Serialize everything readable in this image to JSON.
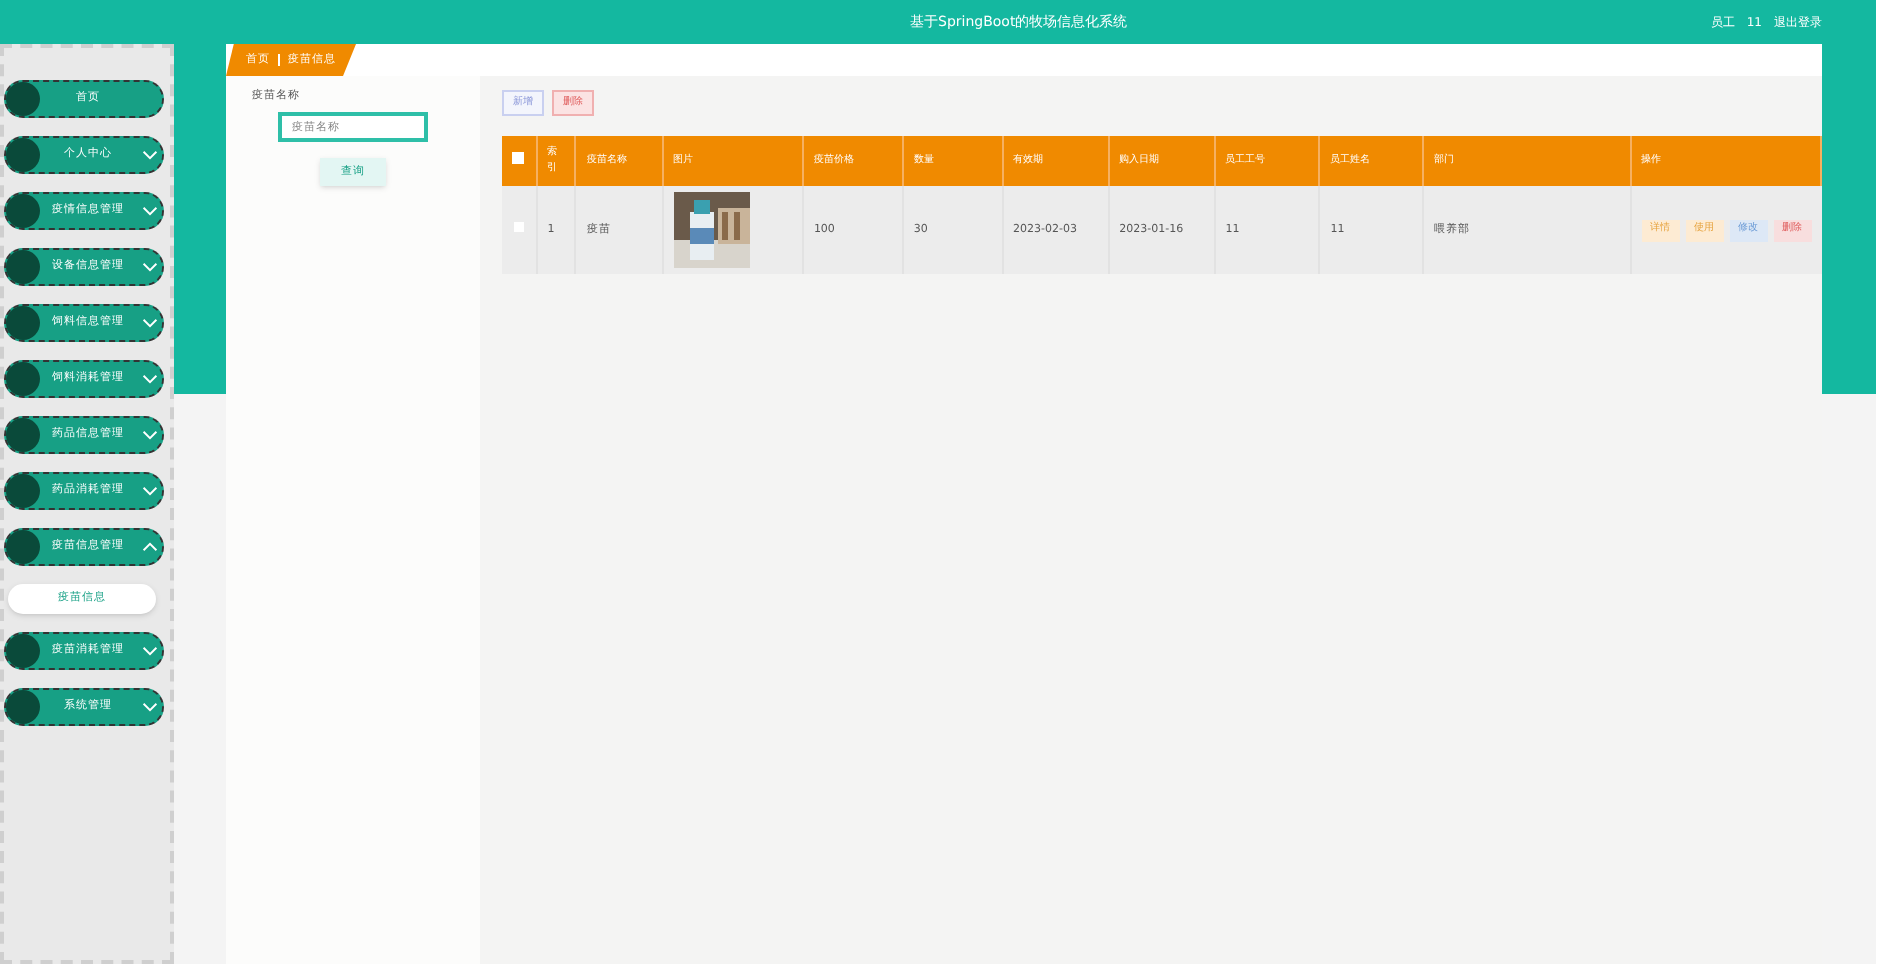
{
  "header": {
    "title": "基于SpringBoot的牧场信息化系统",
    "user_role": "员工",
    "user_name": "11",
    "logout": "退出登录"
  },
  "sidebar": {
    "items": [
      {
        "label": "首页"
      },
      {
        "label": "个人中心",
        "expanded": false
      },
      {
        "label": "疫情信息管理",
        "expanded": false
      },
      {
        "label": "设备信息管理",
        "expanded": false
      },
      {
        "label": "饲料信息管理",
        "expanded": false
      },
      {
        "label": "饲料消耗管理",
        "expanded": false
      },
      {
        "label": "药品信息管理",
        "expanded": false
      },
      {
        "label": "药品消耗管理",
        "expanded": false
      },
      {
        "label": "疫苗信息管理",
        "expanded": true,
        "children": [
          {
            "label": "疫苗信息"
          }
        ]
      },
      {
        "label": "疫苗消耗管理",
        "expanded": false
      },
      {
        "label": "系统管理",
        "expanded": false
      }
    ]
  },
  "breadcrumb": [
    "首页",
    "疫苗信息"
  ],
  "search": {
    "label": "疫苗名称",
    "placeholder": "疫苗名称",
    "button": "查询"
  },
  "toolbar": [
    {
      "label": "新增",
      "kind": "add"
    },
    {
      "label": "删除",
      "kind": "delete"
    }
  ],
  "table": {
    "select_all": false,
    "columns": [
      "索引",
      "疫苗名称",
      "图片",
      "疫苗价格",
      "数量",
      "有效期",
      "购入日期",
      "员工工号",
      "员工姓名",
      "部门",
      "操作"
    ],
    "rows": [
      {
        "checked": false,
        "cells": [
          "1",
          "疫苗",
          {
            "kind": "picture"
          },
          "100",
          "30",
          "2023-02-03",
          "2023-01-16",
          "11",
          "11",
          "喂养部"
        ],
        "actions": [
          {
            "label": "详情",
            "kind": "detail"
          },
          {
            "label": "使用",
            "kind": "use"
          },
          {
            "label": "修改",
            "kind": "edit"
          },
          {
            "label": "删除",
            "kind": "delete"
          }
        ]
      }
    ]
  }
}
